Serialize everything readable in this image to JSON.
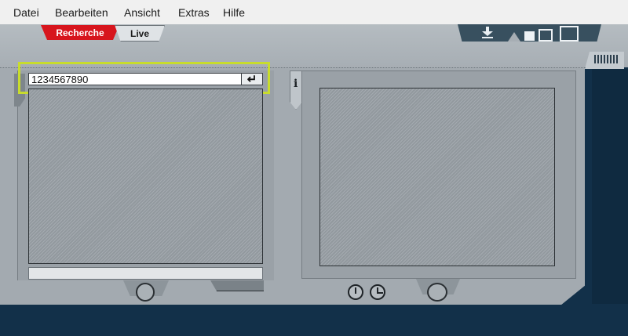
{
  "menubar": {
    "items": [
      "Datei",
      "Bearbeiten",
      "Ansicht",
      "Extras",
      "Hilfe"
    ]
  },
  "tabs": {
    "recherche": "Recherche",
    "live": "Live"
  },
  "search": {
    "value": "1234567890",
    "enter_glyph": "↵"
  },
  "info_glyph": "i",
  "icons": {
    "download": "download-icon",
    "layout_small": "layout-small-icon",
    "layout_medium": "layout-medium-icon",
    "layout_large": "layout-large-icon",
    "clock_start": "clock-start-icon",
    "clock_end": "clock-end-icon",
    "enter": "enter-icon"
  },
  "colors": {
    "accent_red": "#d7151d",
    "highlight": "#c8dc2c",
    "background": "#123049",
    "panel": "#9aa1a7"
  }
}
